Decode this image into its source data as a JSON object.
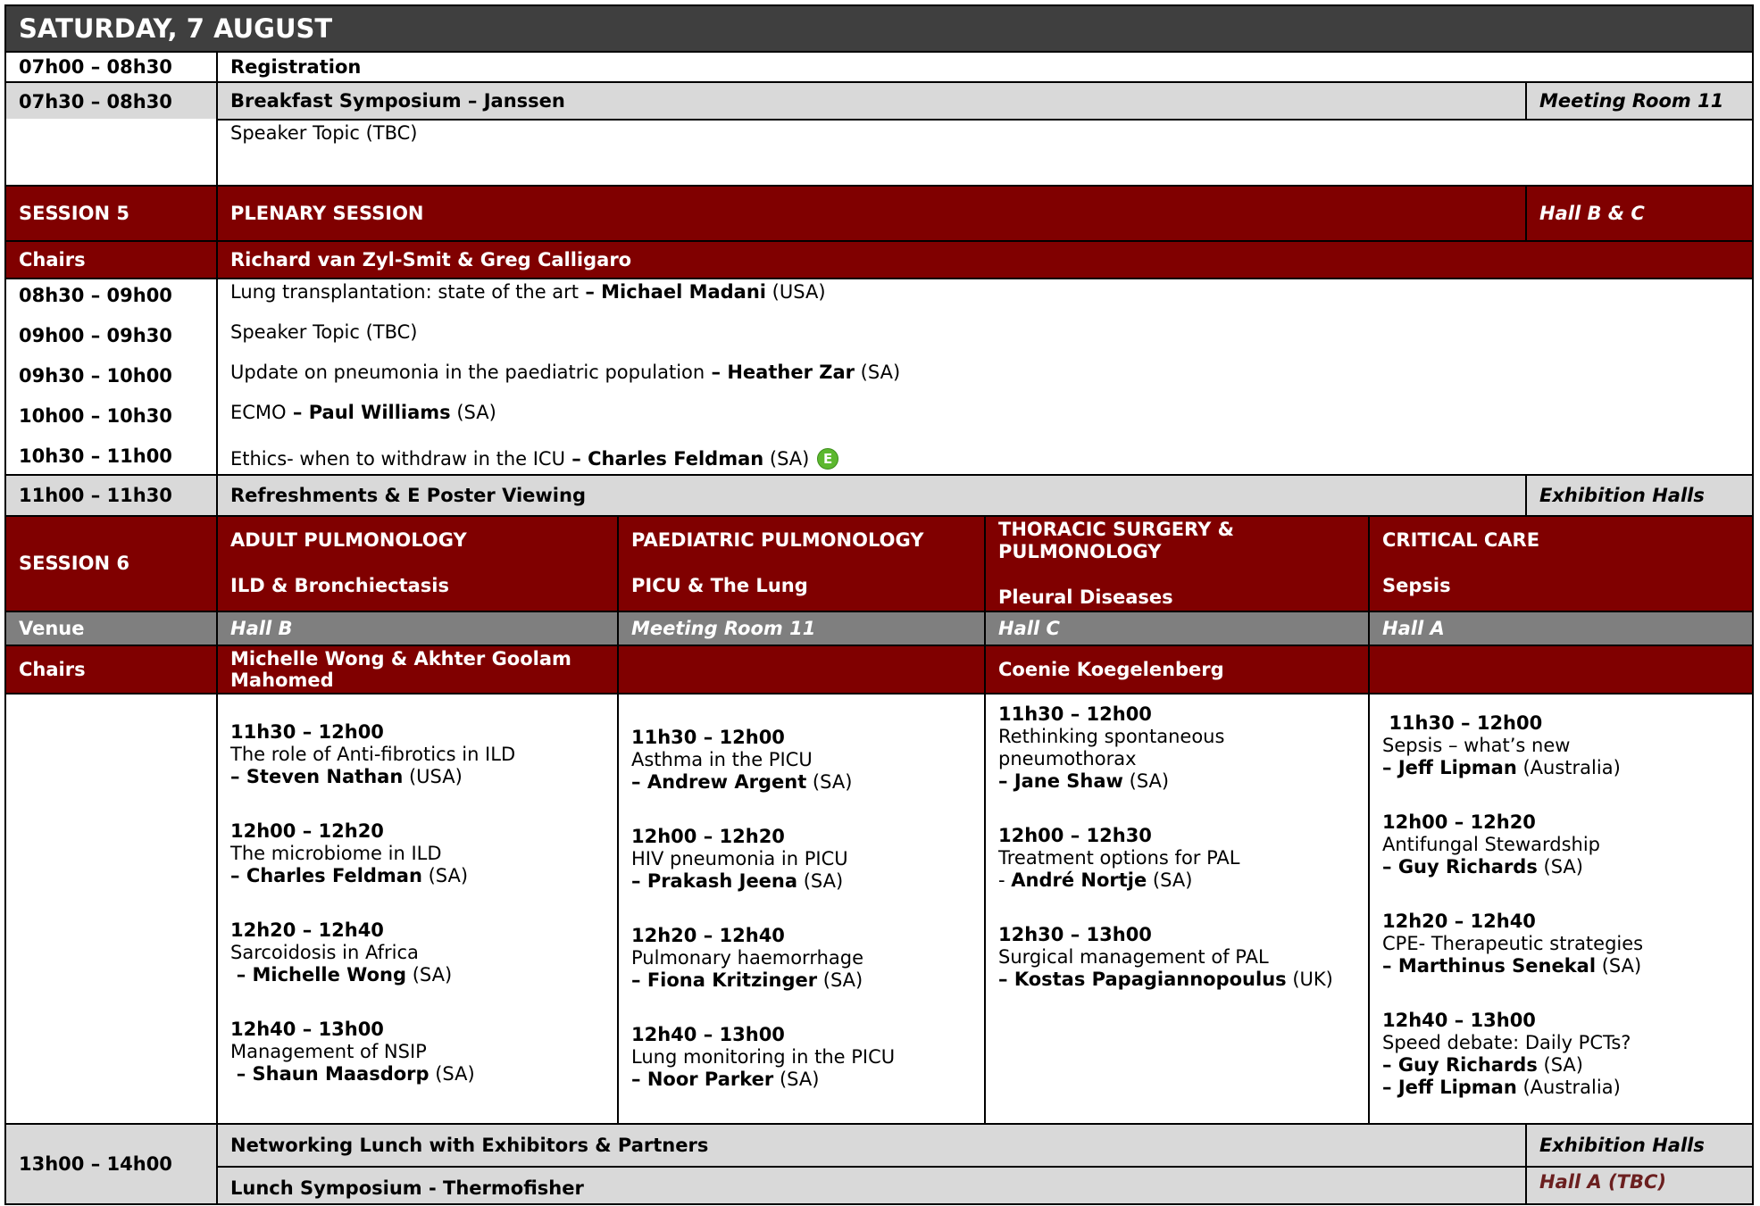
{
  "day_title": "SATURDAY, 7 AUGUST",
  "rows": {
    "registration": {
      "time": "07h00 – 08h30",
      "title": "Registration"
    },
    "breakfast": {
      "time": "07h30 – 08h30",
      "title": "Breakfast Symposium – Janssen",
      "venue": "Meeting Room 11",
      "topic": "Speaker Topic (TBC)"
    },
    "session5": {
      "label": "SESSION 5",
      "title": "PLENARY SESSION",
      "venue": "Hall B & C",
      "chairs_label": "Chairs",
      "chairs": "Richard van Zyl-Smit & Greg Calligaro"
    },
    "refreshments": {
      "time": "11h00 – 11h30",
      "title": "Refreshments & E Poster Viewing",
      "venue": "Exhibition Halls"
    },
    "lunch": {
      "time": "13h00 – 14h00",
      "networking": "Networking Lunch with Exhibitors & Partners",
      "networking_venue": "Exhibition Halls",
      "symposium": "Lunch Symposium - Thermofisher",
      "symposium_venue": "Hall A (TBC)"
    }
  },
  "plenary": [
    {
      "time": "08h30 – 09h00",
      "topic": "Lung transplantation: state of the art",
      "sep": " – ",
      "speaker": "Michael Madani",
      "country": "  (USA)"
    },
    {
      "time": "09h00 – 09h30",
      "topic": "Speaker Topic (TBC)",
      "sep": "",
      "speaker": "",
      "country": ""
    },
    {
      "time": "09h30 – 10h00",
      "topic": "Update on pneumonia in the paediatric population",
      "sep": " – ",
      "speaker": "Heather Zar",
      "country": " (SA)"
    },
    {
      "time": "10h00 – 10h30",
      "topic": "ECMO",
      "sep": " – ",
      "speaker": "Paul Williams",
      "country": " (SA)"
    },
    {
      "time": "10h30 – 11h00",
      "topic": "Ethics- when to withdraw in the ICU",
      "sep": " – ",
      "speaker": "Charles Feldman",
      "country": " (SA)",
      "badge": "E"
    }
  ],
  "session6": {
    "label": "SESSION 6",
    "venue_label": "Venue",
    "chairs_label": "Chairs",
    "tracks": [
      {
        "name": "ADULT PULMONOLOGY",
        "sub": "ILD & Bronchiectasis",
        "venue": "Hall B",
        "chairs": "Michelle Wong & Akhter Goolam Mahomed",
        "slots": [
          {
            "time": "11h30 – 12h00",
            "topic": "The role of Anti-fibrotics in ILD",
            "speaker": "Steven Nathan",
            "country": " (USA)"
          },
          {
            "time": "12h00 – 12h20",
            "topic": "The microbiome in ILD",
            "speaker": "Charles Feldman",
            "country": " (SA)"
          },
          {
            "time": "12h20 – 12h40",
            "topic": "Sarcoidosis in Africa",
            "speaker": "Michelle Wong",
            "country": " (SA)"
          },
          {
            "time": "12h40 – 13h00",
            "topic": "Management of NSIP",
            "speaker": "Shaun Maasdorp",
            "country": " (SA)"
          }
        ]
      },
      {
        "name": "PAEDIATRIC PULMONOLOGY",
        "sub": "PICU & The Lung",
        "venue": "Meeting Room 11",
        "chairs": "",
        "slots": [
          {
            "time": "11h30 – 12h00",
            "topic": "Asthma in the PICU",
            "speaker": "Andrew Argent",
            "country": " (SA)"
          },
          {
            "time": "12h00 – 12h20",
            "topic": "HIV pneumonia in PICU",
            "speaker": "Prakash Jeena",
            "country": " (SA)"
          },
          {
            "time": "12h20 – 12h40",
            "topic": "Pulmonary haemorrhage",
            "speaker": "Fiona Kritzinger",
            "country": " (SA)"
          },
          {
            "time": "12h40 – 13h00",
            "topic": "Lung monitoring in the PICU",
            "speaker": "Noor Parker",
            "country": " (SA)"
          }
        ]
      },
      {
        "name": "THORACIC SURGERY & PULMONOLOGY",
        "sub": "Pleural Diseases",
        "venue": "Hall C",
        "chairs": "Coenie Koegelenberg",
        "slots": [
          {
            "time": "11h30 – 12h00",
            "topic": "Rethinking spontaneous pneumothorax",
            "speaker": "Jane Shaw",
            "country": " (SA)"
          },
          {
            "time": "12h00 – 12h30",
            "topic": "Treatment options for PAL",
            "speaker": "André Nortje",
            "country": " (SA)"
          },
          {
            "time": "12h30 – 13h00",
            "topic": "Surgical management of PAL",
            "speaker": "Kostas Papagiannopoulus",
            "country": " (UK)"
          }
        ]
      },
      {
        "name": "CRITICAL CARE",
        "sub": "Sepsis",
        "venue": "Hall A",
        "chairs": "",
        "slots": [
          {
            "time": "11h30 – 12h00",
            "topic": "Sepsis – what’s new",
            "speaker": "Jeff Lipman",
            "country": " (Australia)"
          },
          {
            "time": "12h00 – 12h20",
            "topic": "Antifungal Stewardship",
            "speaker": "Guy Richards",
            "country": " (SA)"
          },
          {
            "time": "12h20 – 12h40",
            "topic": "CPE- Therapeutic strategies",
            "speaker": "Marthinus Senekal",
            "country": " (SA)"
          },
          {
            "time": "12h40 – 13h00",
            "topic": "Speed debate: Daily PCTs?",
            "speaker": "Guy Richards",
            "country": " (SA)",
            "speaker2": "Jeff Lipman",
            "country2": " (Australia)"
          }
        ]
      }
    ]
  }
}
